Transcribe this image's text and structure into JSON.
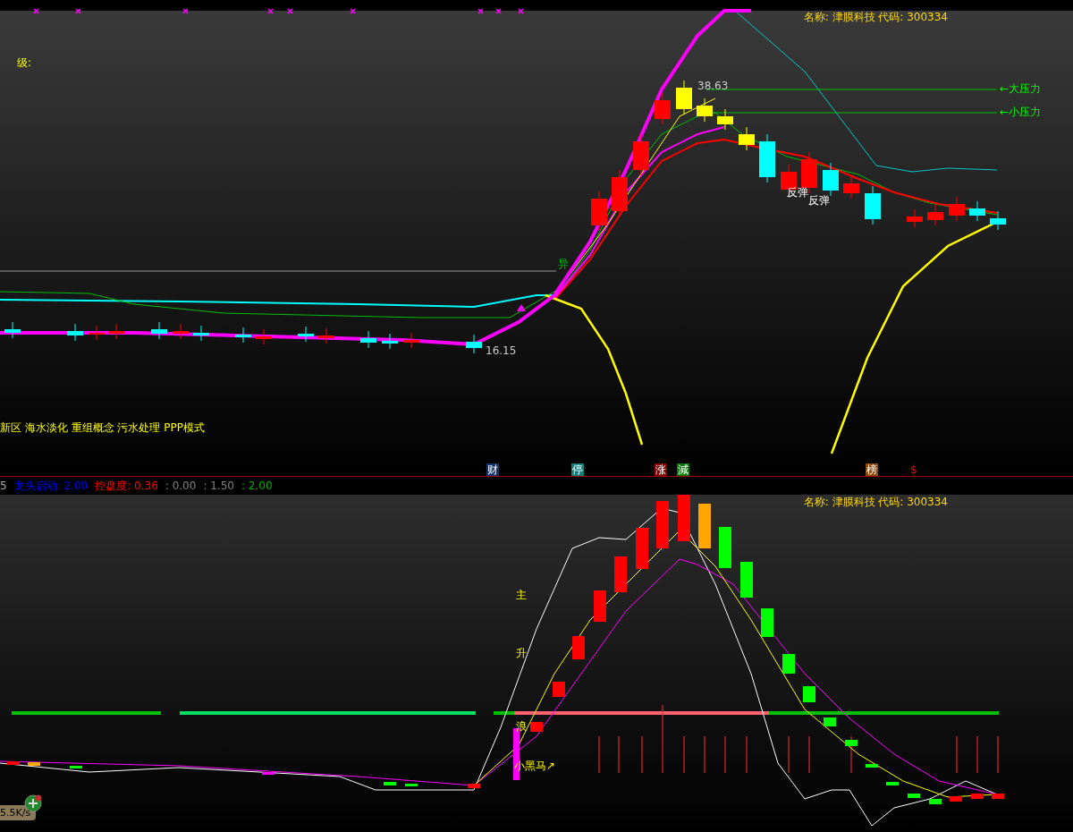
{
  "top_panel": {
    "stock_name": "名称: 津膜科技 代码: 300334",
    "level_label": "级:",
    "high_price": "38.63",
    "low_price": "16.15",
    "pressure_labels": [
      "←大压力",
      "←小压力"
    ],
    "rebound_labels": [
      "反弹",
      "反弹"
    ],
    "signal_label": "异",
    "concepts": "新区 海水淡化 重组概念 污水处理 PPP模式",
    "event_markers": [
      {
        "label": "财",
        "color": "#12346a"
      },
      {
        "label": "停",
        "color": "#10807e"
      },
      {
        "label": "涨",
        "color": "#800000"
      },
      {
        "label": "減",
        "color": "#0a7a0a"
      },
      {
        "label": "榜",
        "color": "#8a4a10"
      }
    ],
    "dollar_marker": "$"
  },
  "indicator_bar": {
    "prefix": "5",
    "items": [
      {
        "name": "龙头启动",
        "value": ": 2.00",
        "color": "#0000ff"
      },
      {
        "name": "控盘度",
        "value": ": 0.36",
        "color": "#ff0000"
      },
      {
        "value": ": 0.00",
        "color": "#808080"
      },
      {
        "value": ": 1.50",
        "color": "#808080"
      },
      {
        "value": ": 2.00",
        "color": "#00b000"
      }
    ]
  },
  "bottom_panel": {
    "stock_name": "名称: 津膜科技 代码: 300334",
    "wave_labels": [
      "主",
      "升",
      "浪"
    ],
    "dark_horse": "小黑马↗"
  },
  "speed_badge": "5.5K/s"
}
